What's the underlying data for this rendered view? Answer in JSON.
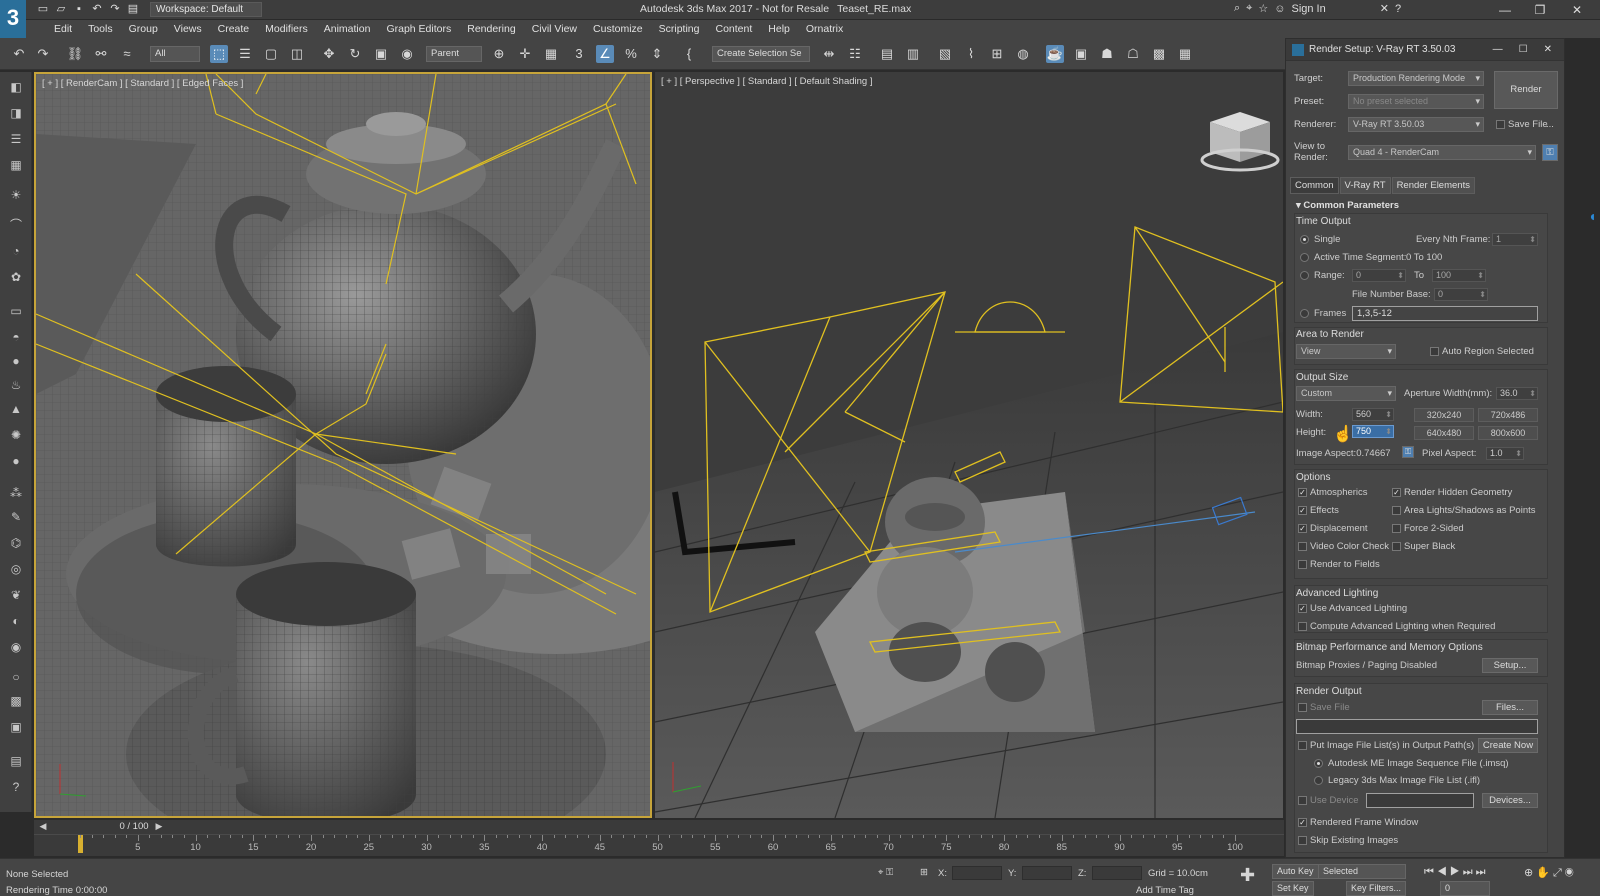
{
  "titlebar": {
    "logo": "3",
    "workspace": "Workspace: Default",
    "title": "Autodesk 3ds Max 2017 - Not for Resale",
    "project": "Teaset_RE.max",
    "signin": "Sign In"
  },
  "menu": [
    "Edit",
    "Tools",
    "Group",
    "Views",
    "Create",
    "Modifiers",
    "Animation",
    "Graph Editors",
    "Rendering",
    "Civil View",
    "Customize",
    "Scripting",
    "Content",
    "Help",
    "Ornatrix"
  ],
  "toolbar": {
    "filter": "All",
    "ref_coord": "Parent",
    "selection_set": "Create Selection Se"
  },
  "viewports": {
    "left": "[ + ] [ RenderCam ] [ Standard ] [ Edged Faces ]",
    "right": "[ + ] [ Perspective ] [ Standard ] [ Default Shading ]"
  },
  "timeslider": {
    "value": "0 / 100"
  },
  "ruler": {
    "labels": [
      "5",
      "10",
      "15",
      "20",
      "25",
      "30",
      "35",
      "40",
      "45",
      "50",
      "55",
      "60",
      "65",
      "70",
      "75",
      "80",
      "85",
      "90",
      "95",
      "100"
    ]
  },
  "status": {
    "selection": "None Selected",
    "rendering_time": "Rendering Time  0:00:00",
    "x_label": "X:",
    "y_label": "Y:",
    "z_label": "Z:",
    "grid": "Grid = 10.0cm",
    "auto_key": "Auto Key",
    "set_key": "Set Key",
    "selected": "Selected",
    "key_filters": "Key Filters...",
    "add_time_tag": "Add Time Tag",
    "frame": "0"
  },
  "render_setup": {
    "title": "Render Setup: V-Ray RT 3.50.03",
    "target_label": "Target:",
    "target": "Production Rendering Mode",
    "preset_label": "Preset:",
    "preset": "No preset selected",
    "renderer_label": "Renderer:",
    "renderer": "V-Ray RT 3.50.03",
    "save_file": "Save File",
    "render_btn": "Render",
    "more": "...",
    "view_label": "View to Render:",
    "view": "Quad 4 - RenderCam",
    "tabs": [
      "Common",
      "V-Ray RT",
      "Render Elements"
    ],
    "rollout": "Common Parameters",
    "time_output": "Time Output",
    "single": "Single",
    "every_nth": "Every Nth Frame:",
    "every_nth_val": "1",
    "active_segment": "Active Time Segment:",
    "segment_val": "0 To 100",
    "range": "Range:",
    "range_from": "0",
    "to": "To",
    "range_to": "100",
    "file_number_base": "File Number Base:",
    "fnb_val": "0",
    "frames": "Frames",
    "frames_val": "1,3,5-12",
    "area_to_render": "Area to Render",
    "area": "View",
    "auto_region": "Auto Region Selected",
    "output_size": "Output Size",
    "size_preset": "Custom",
    "aperture": "Aperture Width(mm):",
    "aperture_val": "36.0",
    "width_label": "Width:",
    "width": "560",
    "height_label": "Height:",
    "height": "750",
    "p1": "320x240",
    "p2": "720x486",
    "p3": "640x480",
    "p4": "800x600",
    "image_aspect": "Image Aspect:0.74667",
    "pixel_aspect": "Pixel Aspect:",
    "pixel_aspect_val": "1.0",
    "options": "Options",
    "atmospherics": "Atmospherics",
    "render_hidden": "Render Hidden Geometry",
    "effects": "Effects",
    "area_lights": "Area Lights/Shadows as Points",
    "displacement": "Displacement",
    "force_2sided": "Force 2-Sided",
    "video_color": "Video Color Check",
    "super_black": "Super Black",
    "render_fields": "Render to Fields",
    "advanced_lighting": "Advanced Lighting",
    "use_adv": "Use Advanced Lighting",
    "compute_adv": "Compute Advanced Lighting when Required",
    "bitmap_perf": "Bitmap Performance and Memory Options",
    "bitmap_proxies": "Bitmap Proxies / Paging Disabled",
    "setup": "Setup...",
    "render_output": "Render Output",
    "save_file2": "Save File",
    "files": "Files...",
    "put_image": "Put Image File List(s) in Output Path(s)",
    "create_now": "Create Now",
    "autodesk_me": "Autodesk ME Image Sequence File (.imsq)",
    "legacy": "Legacy 3ds Max Image File List (.ifl)",
    "use_device": "Use Device",
    "devices": "Devices...",
    "rendered_frame": "Rendered Frame Window",
    "skip_existing": "Skip Existing Images",
    "check": "✓"
  }
}
